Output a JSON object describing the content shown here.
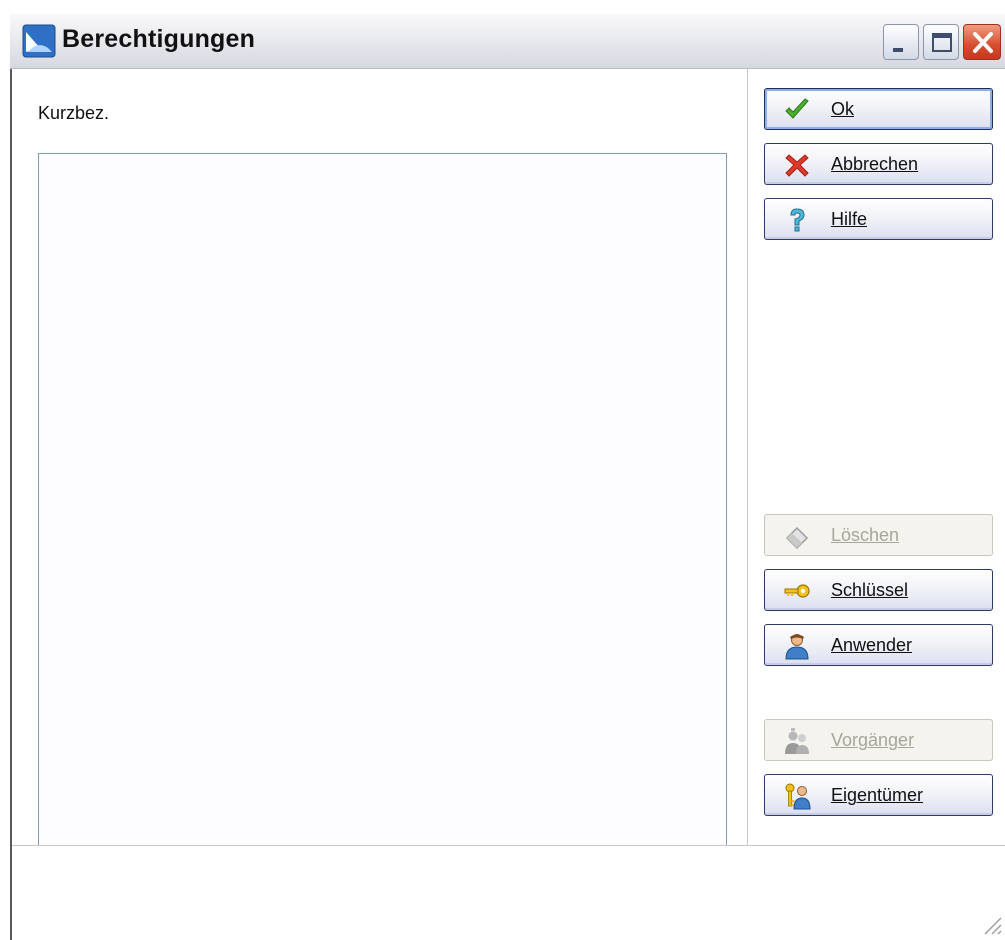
{
  "window": {
    "title": "Berechtigungen"
  },
  "form": {
    "kurzbez_label": "Kurzbez."
  },
  "buttons": {
    "ok": {
      "label": "Ok",
      "icon": "checkmark-icon",
      "enabled": true
    },
    "abbrechen": {
      "label": "Abbrechen",
      "icon": "x-icon",
      "enabled": true
    },
    "hilfe": {
      "label": "Hilfe",
      "icon": "question-icon",
      "enabled": true
    },
    "loeschen": {
      "label": "Löschen",
      "icon": "eraser-icon",
      "enabled": false
    },
    "schluessel": {
      "label": "Schlüssel",
      "icon": "key-icon",
      "enabled": true
    },
    "anwender": {
      "label": "Anwender",
      "icon": "user-icon",
      "enabled": true
    },
    "vorgaenger": {
      "label": "Vorgänger",
      "icon": "users-icon",
      "enabled": false
    },
    "eigentuemer": {
      "label": "Eigentümer",
      "icon": "owner-icon",
      "enabled": true
    }
  },
  "colors": {
    "titlebar": "#e6e7ec",
    "close_red": "#d64d2f",
    "list_border": "#7f9db9",
    "button_border": "#2d3b6a"
  }
}
